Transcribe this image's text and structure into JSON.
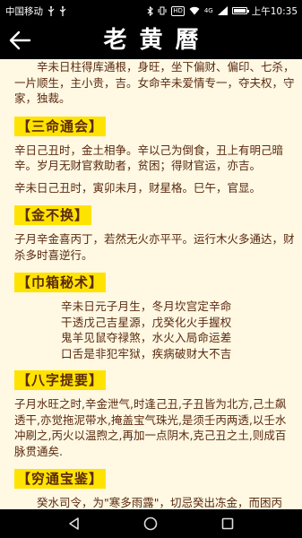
{
  "status_bar": {
    "carrier": "中国移动",
    "left_icons": [
      "usb-icon",
      "usb-icon"
    ],
    "badges": [
      "HD",
      "4G"
    ],
    "time": "上午10:35"
  },
  "header": {
    "title": "老黄曆"
  },
  "content": {
    "intro": "　　辛未日柱得库通根，身旺，坐下偏财、偏印、七杀，一片顺生，主小贵，吉。女命辛未爱情专一，夺夫权，守家，独裁。",
    "sections": [
      {
        "title": "【三命通会】",
        "paragraphs": [
          "辛日己丑时，金土相争。辛以己为倒食，丑上有明己暗辛。岁月无财官救助者，贫困；得财官运，亦吉。",
          "辛未日己丑时，寅卯未月，财星格。巳午，官显。"
        ]
      },
      {
        "title": "【金不换】",
        "paragraphs": [
          "子月辛金喜丙丁，若然无火亦平平。运行木火多通达，财杀多时喜逆行。"
        ]
      },
      {
        "title": "【巾箱秘术】",
        "verse": "辛未日元子月生，冬月坎宫定辛命\n干透戊己吉星源，戊癸化火手握权\n鬼羊见鼠夺禄煞，水火入局命运差\n口舌是非犯牢狱，疾病破财大不吉"
      },
      {
        "title": "【八字提要】",
        "paragraphs": [
          "子月水旺之时,辛金泄气,时逢己丑,子丑皆为北方,己土飙透干,亦觉拖泥带水,掩盖宝气珠光,是须壬丙两透,以壬水冲刷之,丙火以温煦之,再加一点阴木,克己丑之土,则成百脉贯通矣."
        ]
      },
      {
        "title": "【穷通宝鉴】",
        "paragraphs": [
          "　　癸水司令，为\"寒多雨露\"，切忌癸出冻金，而困丙火。壬丙两透，不见戊癸，衣锦腰金。\n　　即壬藏丙透，一榜堪图。"
        ]
      }
    ]
  },
  "nav": {
    "buttons": [
      "back-triangle-icon",
      "home-circle-icon",
      "recents-square-icon"
    ]
  },
  "colors": {
    "background": "#fff8e3",
    "text": "#5a2a10",
    "highlight": "#ffe300",
    "bars": "#000000"
  }
}
